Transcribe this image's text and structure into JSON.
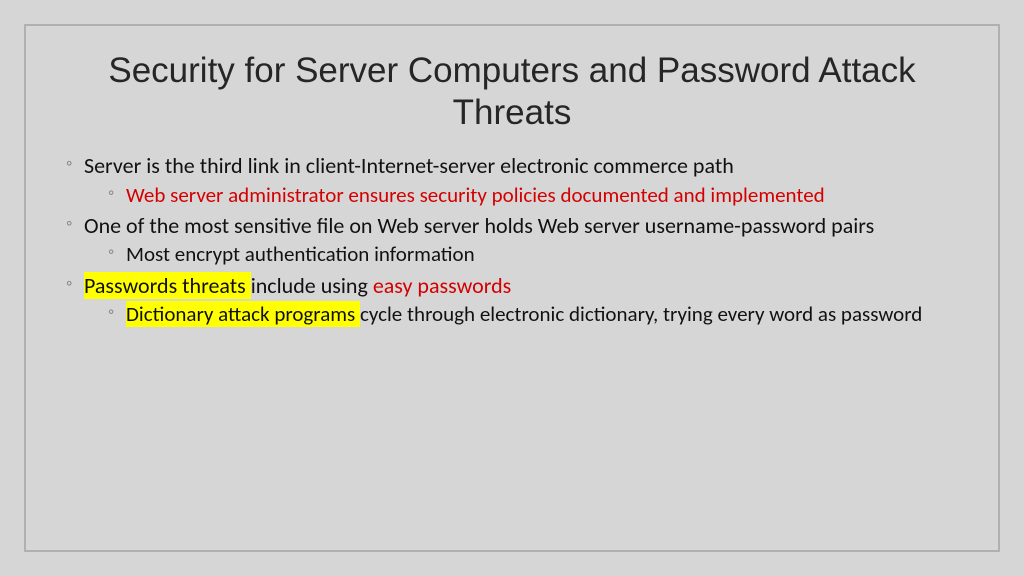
{
  "title": "Security for Server Computers and Password Attack Threats",
  "bullets": {
    "b1": "Server is the third link in client-Internet-server electronic commerce path",
    "b1a": "Web server administrator ensures security policies documented and implemented",
    "b2": "One of the most sensitive file on Web server holds Web server username-password pairs",
    "b2a": "Most encrypt authentication information",
    "b3_hl": "Passwords threats ",
    "b3_mid": "include using ",
    "b3_red": "easy passwords",
    "b3a_hl": "Dictionary attack programs ",
    "b3a_rest": "cycle through electronic dictionary, trying every word as password"
  }
}
